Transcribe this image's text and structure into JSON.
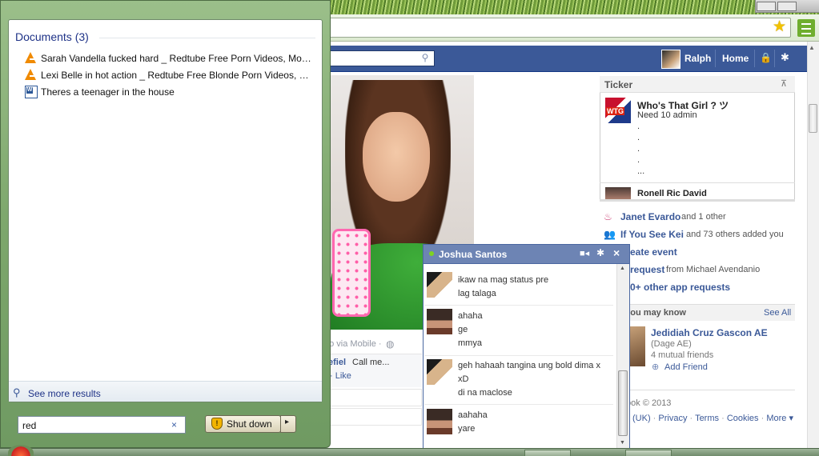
{
  "start_menu": {
    "documents_header": "Documents (3)",
    "documents": [
      {
        "title": "Sarah Vandella fucked hard _ Redtube Free Porn Videos, Movie...",
        "icon": "vlc-icon"
      },
      {
        "title": "Lexi Belle in hot action _ Redtube Free Blonde Porn Videos, Mo...",
        "icon": "vlc-icon"
      },
      {
        "title": "Theres a teenager in the house",
        "icon": "word-document-icon"
      }
    ],
    "see_more": "See more results",
    "search_value": "red",
    "search_clear": "×",
    "shutdown_label": "Shut down",
    "shutdown_arrow": "▸"
  },
  "browser": {
    "star": "★"
  },
  "facebook": {
    "user_name": "Ralph",
    "home": "Home",
    "search_icon": "⚲",
    "photo_caption": "go via Mobile ·",
    "comment_name": "efiel",
    "comment_text": "Call me...",
    "like": "· Like",
    "ticker": {
      "title": "Ticker",
      "items": [
        {
          "name": "Who's That Girl ? ツ",
          "text": "Need 10 admin",
          "badge": "WTG"
        },
        {
          "name": "Ronell Ric David",
          "text": ""
        }
      ],
      "dots": [
        ".",
        ".",
        ".",
        ".",
        "..."
      ]
    },
    "right_column": {
      "birthday_name": "Janet Evardo",
      "birthday_rest": "and 1 other",
      "group_name": "If You See Kei",
      "group_rest": "and 73 others added you",
      "create_event": "eate event",
      "request_link": "request",
      "request_rest": "from Michael Avendanio",
      "app_requests": "0+ other app requests"
    },
    "people_you_may_know": {
      "title": "e you may know",
      "see_all": "See All",
      "name": "Jedidiah Cruz Gascon AE",
      "sub": "(Dage AE)",
      "mutual": "4 mutual friends",
      "add_friend": "Add Friend"
    },
    "footer": {
      "copyright": "ook © 2013",
      "links": [
        "(UK)",
        "Privacy",
        "Terms",
        "Cookies",
        "More ▾"
      ]
    }
  },
  "chat": {
    "title": "Joshua Santos",
    "messages": [
      {
        "avatar": "a",
        "lines": [
          "ikaw na mag status pre",
          "lag talaga"
        ]
      },
      {
        "avatar": "b",
        "lines": [
          "ahaha",
          "ge",
          "mmya"
        ]
      },
      {
        "avatar": "a",
        "lines": [
          "geh hahaah tangina ung bold dima x",
          "xD",
          "di na maclose"
        ]
      },
      {
        "avatar": "b",
        "lines": [
          "aahaha",
          "yare"
        ]
      }
    ]
  },
  "colors": {
    "facebook_blue": "#3b5998",
    "chat_header": "#6d84b4",
    "start_menu_frame": "#7da76c"
  }
}
